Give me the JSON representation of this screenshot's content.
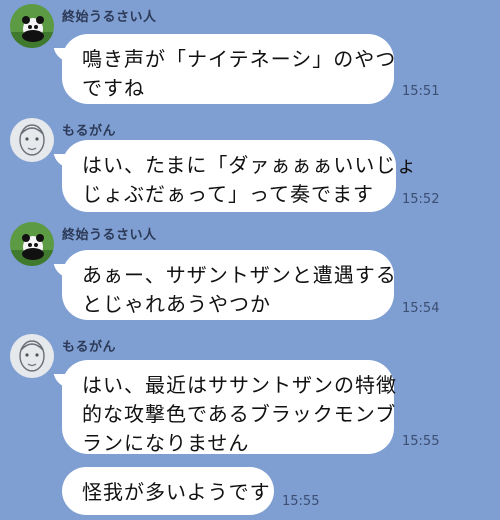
{
  "messages": [
    {
      "sender": "終始うるさい人",
      "text": "鳴き声が「ナイテネーシ」のやつ\nですね",
      "time": "15:51",
      "avatar": "panda-avatar"
    },
    {
      "sender": "もるがん",
      "text": "はい、たまに「ダァぁぁぁいいじょ\nじょぶだぁって」って奏でます",
      "time": "15:52",
      "avatar": "sketch-avatar"
    },
    {
      "sender": "終始うるさい人",
      "text": "あぁー、サザントザンと遭遇する\nとじゃれあうやつか",
      "time": "15:54",
      "avatar": "panda-avatar"
    },
    {
      "sender": "もるがん",
      "text": "はい、最近はササントザンの特徴\n的な攻撃色であるブラックモンブ\nランになりません",
      "time": "15:55",
      "avatar": "sketch-avatar"
    },
    {
      "sender": "",
      "text": "怪我が多いようです",
      "time": "15:55",
      "avatar": ""
    }
  ],
  "colors": {
    "background": "#7f9ed2",
    "bubble": "#ffffff"
  }
}
